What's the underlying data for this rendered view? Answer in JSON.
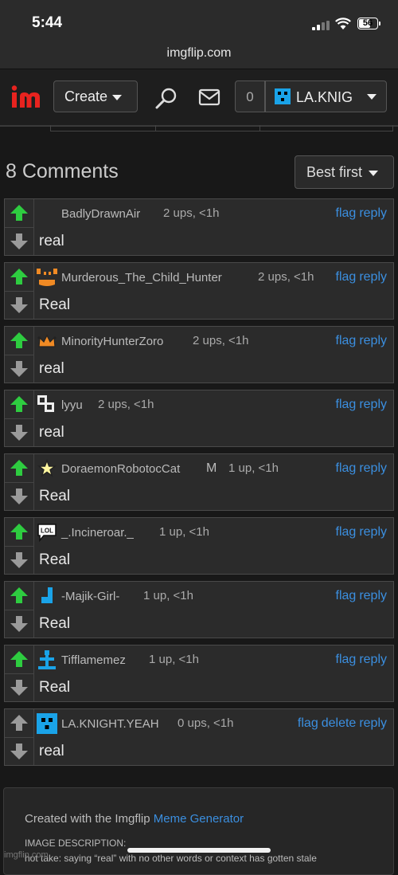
{
  "status_bar": {
    "time": "5:44",
    "battery": "56"
  },
  "browser": {
    "url": "imgflip.com"
  },
  "nav": {
    "create_label": "Create",
    "notification_count": "0",
    "username": "LA.KNIG"
  },
  "comments_header": {
    "title": "8 Comments",
    "sort_label": "Best first"
  },
  "comments": [
    {
      "user": "BadlyDrawnAir",
      "meta": "2 ups, <1h",
      "text": "real",
      "actions": [
        "flag",
        "reply"
      ],
      "avatar_icon": "none",
      "upvoted": true
    },
    {
      "user": "Murderous_The_Child_Hunter",
      "meta": "2 ups, <1h",
      "text": "Real",
      "actions": [
        "flag",
        "reply"
      ],
      "avatar_icon": "orange-face-icon",
      "upvoted": true
    },
    {
      "user": "MinorityHunterZoro",
      "meta": "2 ups, <1h",
      "text": "real",
      "actions": [
        "flag",
        "reply"
      ],
      "avatar_icon": "crown-icon",
      "upvoted": true
    },
    {
      "user": "lyyu",
      "meta": "2 ups, <1h",
      "text": "real",
      "actions": [
        "flag",
        "reply"
      ],
      "avatar_icon": "pixel-block-icon",
      "upvoted": true
    },
    {
      "user": "DoraemonRobotocCat",
      "badge": "M",
      "meta": "1 up, <1h",
      "text": "Real",
      "actions": [
        "flag",
        "reply"
      ],
      "avatar_icon": "star-icon",
      "upvoted": true
    },
    {
      "user": "_.Incineroar._",
      "meta": "1 up, <1h",
      "text": "Real",
      "actions": [
        "flag",
        "reply"
      ],
      "avatar_icon": "lol-speech-icon",
      "avatar_text": "LOL",
      "upvoted": true
    },
    {
      "user": "-Majik-Girl-",
      "meta": "1 up, <1h",
      "text": "Real",
      "actions": [
        "flag",
        "reply"
      ],
      "avatar_icon": "blue-pixel-icon",
      "upvoted": true
    },
    {
      "user": "Tifflamemez",
      "meta": "1 up, <1h",
      "text": "Real",
      "actions": [
        "flag",
        "reply"
      ],
      "avatar_icon": "blue-cross-icon",
      "upvoted": true
    },
    {
      "user": "LA.KNIGHT.YEAH",
      "meta": "0 ups, <1h",
      "text": "real",
      "actions": [
        "flag",
        "delete",
        "reply"
      ],
      "avatar_icon": "blue-face-icon",
      "upvoted": false
    }
  ],
  "footer": {
    "created_with": "Created with the Imgflip",
    "generator_link": "Meme Generator",
    "image_description_label": "IMAGE DESCRIPTION:",
    "image_description": "hot take: saying “real” with no other words or context has gotten stale",
    "watermark": "imgflip.com"
  },
  "colors": {
    "upvote": "#2ecc40",
    "link": "#3b8fe0",
    "accent_blue": "#1aa3e8",
    "logo_red": "#e8231f"
  }
}
